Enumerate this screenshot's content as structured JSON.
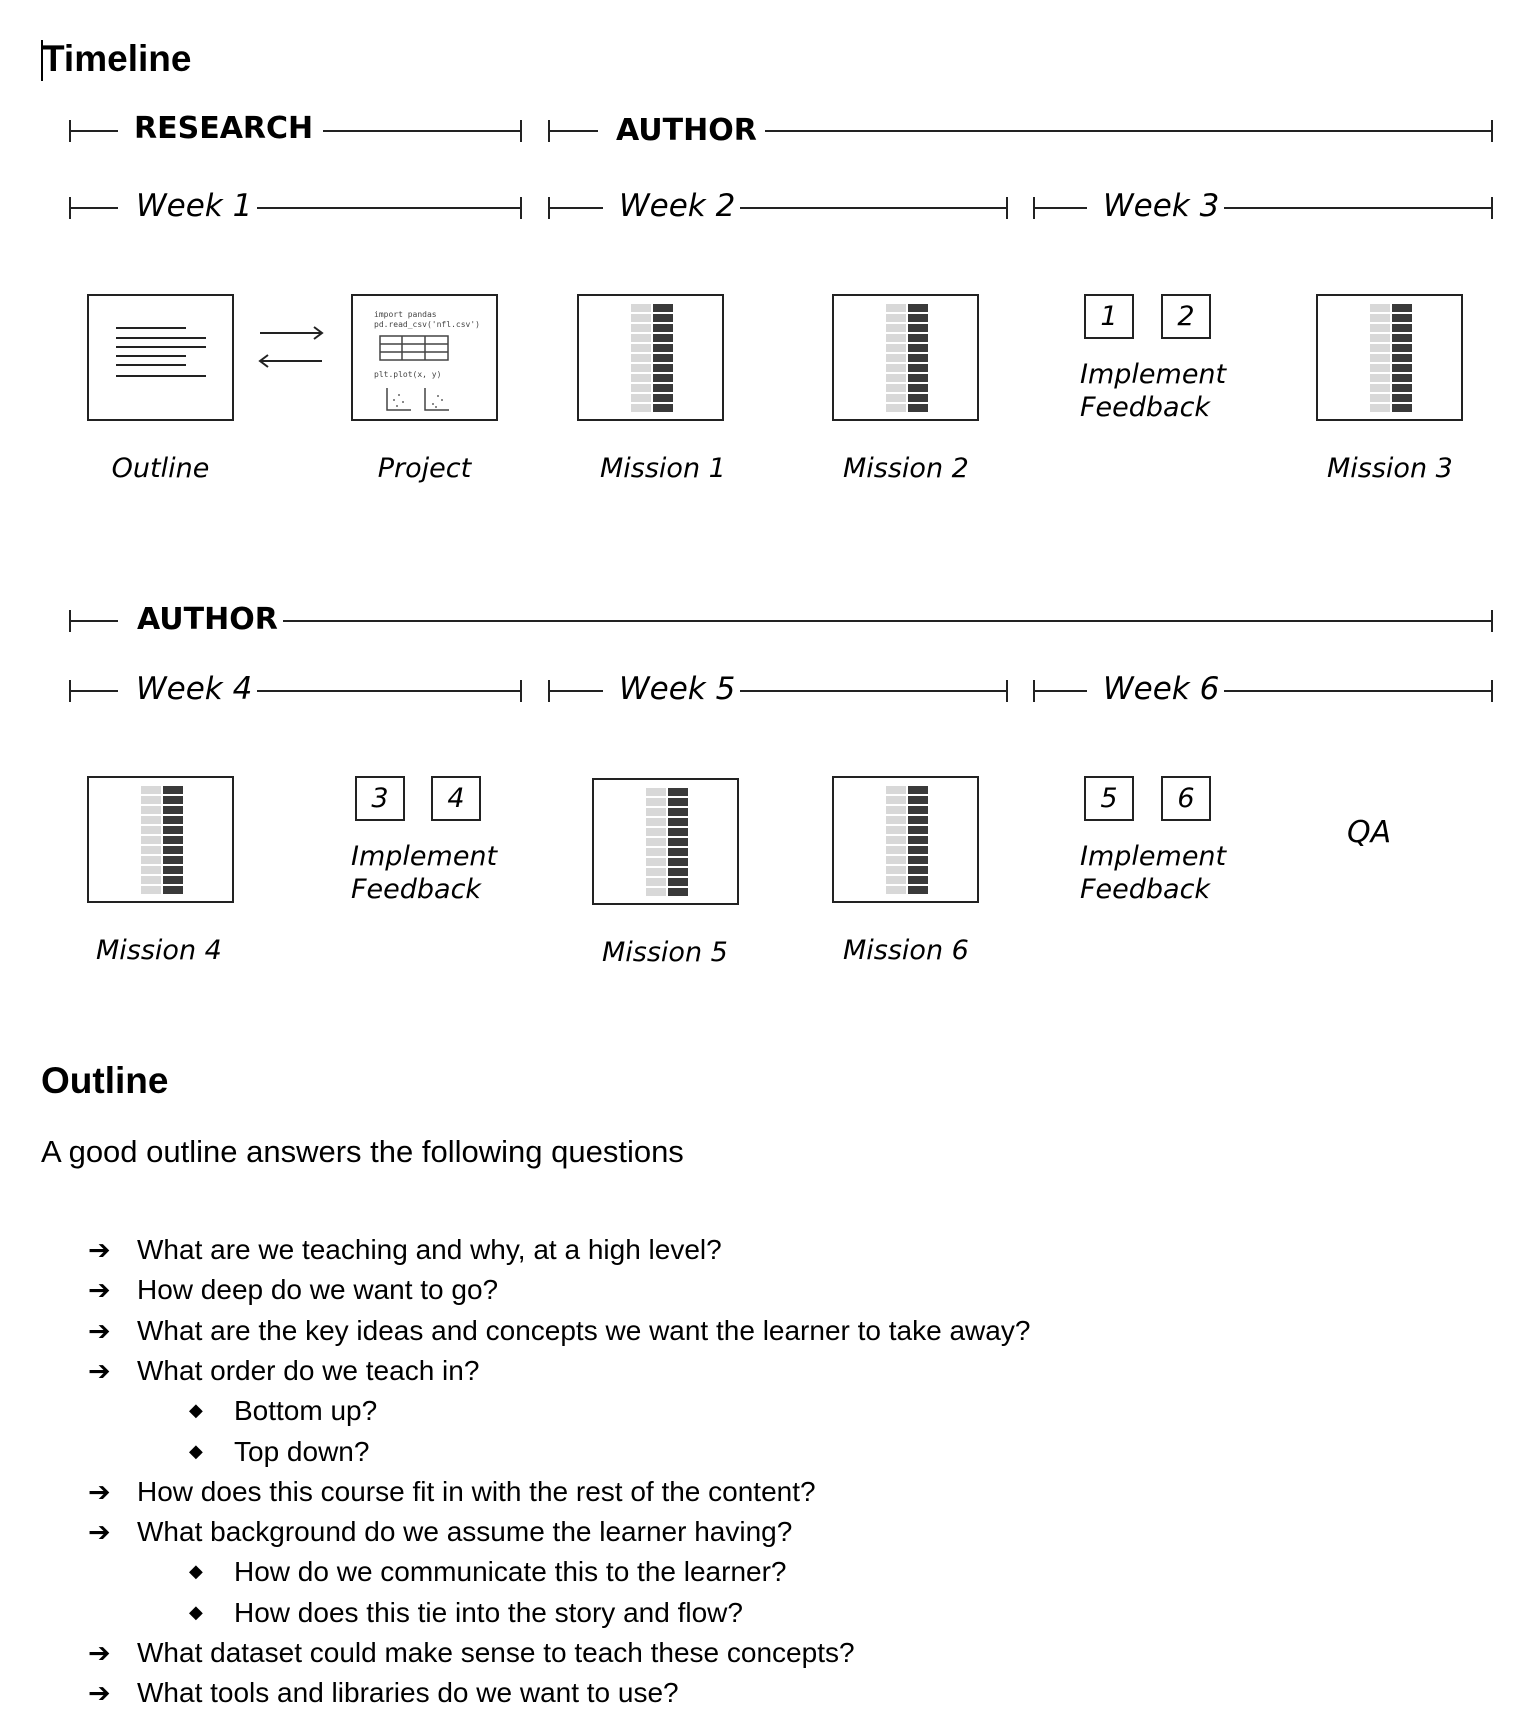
{
  "timeline": {
    "title": "Timeline",
    "row1": {
      "phase_research": "RESEARCH",
      "phase_author": "AUTHOR",
      "week1": "Week 1",
      "week2": "Week 2",
      "week3": "Week 3",
      "outline_label": "Outline",
      "project_label": "Project",
      "mission1_label": "Mission 1",
      "mission2_label": "Mission 2",
      "mission3_label": "Mission 3",
      "feedback_box_1": "1",
      "feedback_box_2": "2",
      "implement": "Implement",
      "feedback": "Feedback",
      "project_code_line1": "import pandas",
      "project_code_line2": "pd.read_csv('nfl.csv')",
      "project_code_line3": "plt.plot(x, y)"
    },
    "row2": {
      "phase_author": "AUTHOR",
      "week4": "Week 4",
      "week5": "Week 5",
      "week6": "Week 6",
      "mission4_label": "Mission 4",
      "mission5_label": "Mission 5",
      "mission6_label": "Mission 6",
      "qa_label": "QA",
      "feedback_box_3": "3",
      "feedback_box_4": "4",
      "feedback_box_5": "5",
      "feedback_box_6": "6",
      "implement": "Implement",
      "feedback": "Feedback"
    }
  },
  "outline": {
    "heading": "Outline",
    "intro": "A good outline answers the following questions",
    "questions": [
      "What are we teaching and why, at a high level?",
      "How deep do we want to go?",
      "What are the key ideas and concepts we want the learner to take away?",
      "What order do we teach in?",
      "How does this course fit in with the rest of the content?",
      "What background do we assume the learner having?",
      "What dataset could make sense to teach these concepts?",
      "What tools and libraries do we want to use?"
    ],
    "order_subitems": [
      "Bottom up?",
      "Top down?"
    ],
    "background_subitems": [
      "How do we communicate this to the learner?",
      "How does this tie into the story and flow?"
    ],
    "bullet_arrow": "➔",
    "bullet_diamond": "◆"
  }
}
